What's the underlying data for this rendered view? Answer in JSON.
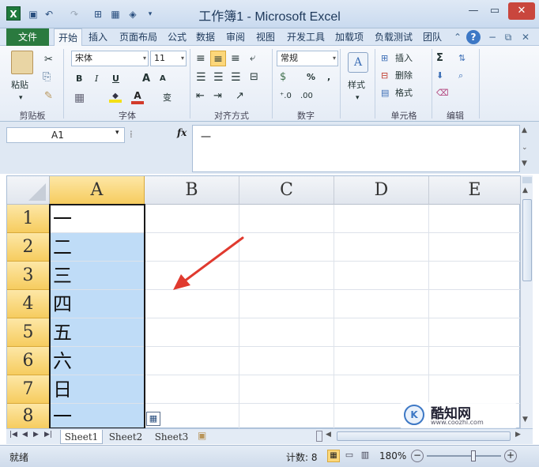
{
  "title_bar": {
    "app_icon": "X",
    "title": "工作簿1 - Microsoft Excel",
    "qat_icons": [
      "save-icon",
      "undo-icon",
      "redo-icon",
      "customize-icon"
    ]
  },
  "tabs": {
    "file": "文件",
    "items": [
      "开始",
      "插入",
      "页面布局",
      "公式",
      "数据",
      "审阅",
      "视图",
      "开发工具",
      "加载项",
      "负载测试",
      "团队"
    ]
  },
  "ribbon": {
    "clipboard": {
      "paste": "粘贴",
      "label": "剪贴板"
    },
    "font": {
      "name": "宋体",
      "size": "11",
      "bold": "B",
      "italic": "I",
      "underline": "U",
      "grow": "A",
      "shrink": "A",
      "color_letter": "A",
      "phonetic": "变",
      "label": "字体"
    },
    "alignment": {
      "label": "对齐方式"
    },
    "number": {
      "format": "常规",
      "percent": "%",
      "comma": ",",
      "label": "数字"
    },
    "styles": {
      "label": "样式"
    },
    "cells": {
      "insert": "插入",
      "delete": "删除",
      "format": "格式",
      "label": "单元格"
    },
    "editing": {
      "sum": "Σ",
      "label": "编辑"
    }
  },
  "formula_bar": {
    "name_box": "A1",
    "fx": "fx",
    "content": "一"
  },
  "grid": {
    "columns": [
      "A",
      "B",
      "C",
      "D",
      "E"
    ],
    "rows": [
      "1",
      "2",
      "3",
      "4",
      "5",
      "6",
      "7",
      "8"
    ],
    "col_a_values": [
      "一",
      "二",
      "三",
      "四",
      "五",
      "六",
      "日",
      "一"
    ],
    "selected_column": "A",
    "selection_fill": "#bfdcf7",
    "arrow_color": "#e03a2f"
  },
  "sheets": {
    "tabs": [
      "Sheet1",
      "Sheet2",
      "Sheet3"
    ],
    "active": "Sheet1"
  },
  "status_bar": {
    "ready": "就绪",
    "count": "计数: 8",
    "zoom": "180%"
  },
  "watermark": {
    "text": "酷知网",
    "url": "www.coozhi.com"
  }
}
